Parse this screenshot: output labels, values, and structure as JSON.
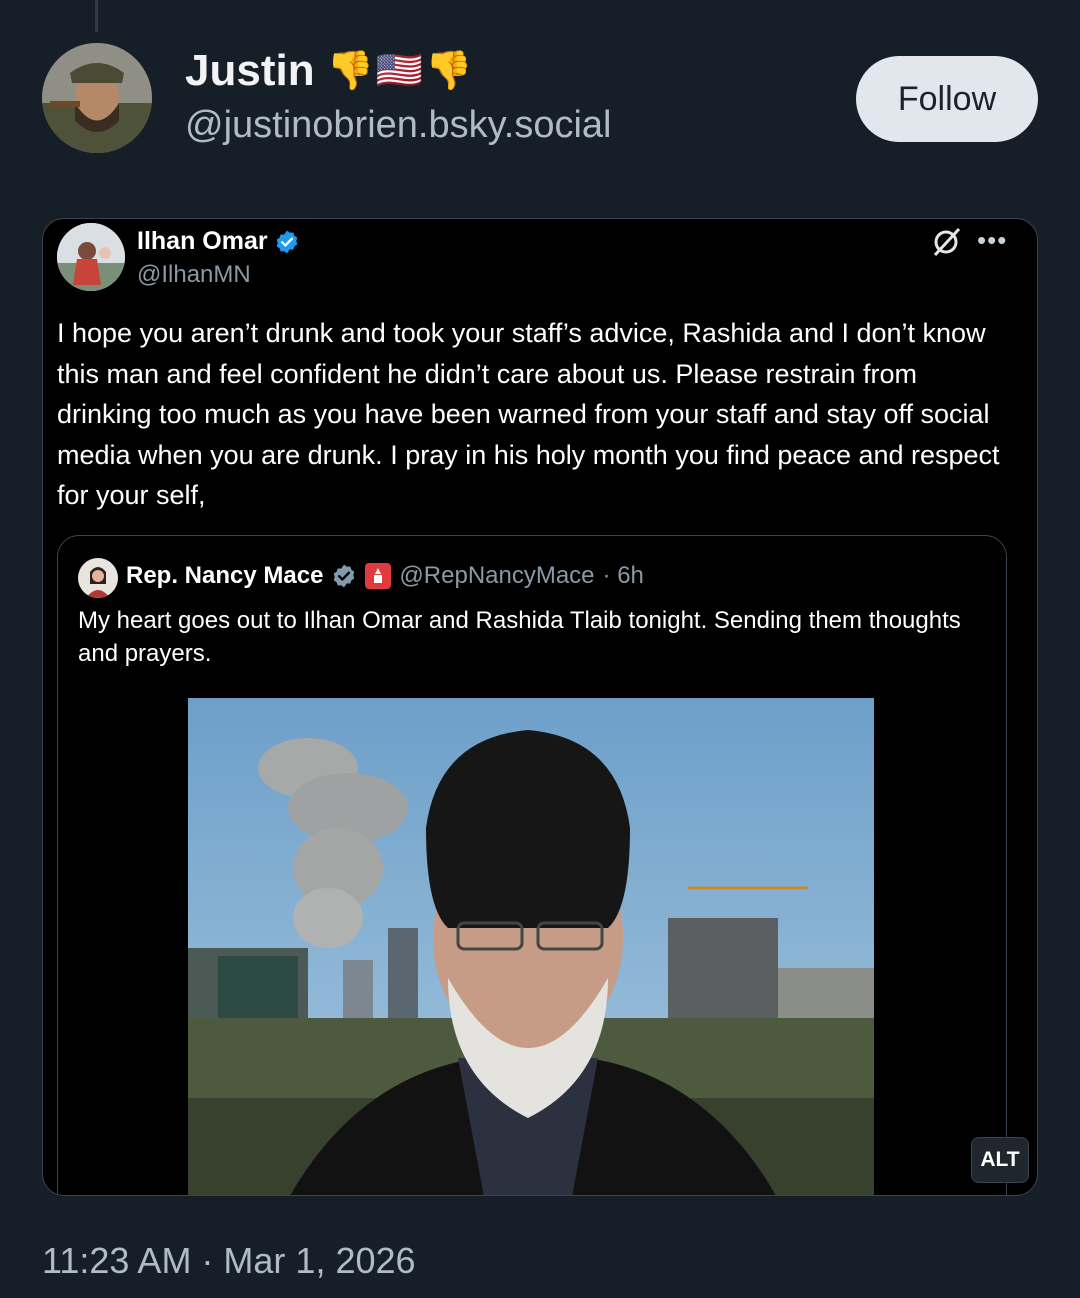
{
  "post": {
    "author": {
      "display_name": "Justin",
      "emojis": [
        "👎",
        "🇺🇸",
        "👎"
      ],
      "handle": "@justinobrien.bsky.social"
    },
    "follow_label": "Follow",
    "timestamp": "11:23 AM · Mar 1, 2026"
  },
  "embedded_tweet": {
    "author": {
      "display_name": "Ilhan Omar",
      "handle": "@IlhanMN",
      "verified": true
    },
    "body": "I hope you aren’t drunk and took your staff’s advice, Rashida and I don’t know this man and feel confident he didn’t care about us. Please restrain from drinking too much as you have been warned from your staff and stay off social media when you are drunk. I pray in his holy month you find peace and respect for your self,",
    "quoted": {
      "display_name": "Rep. Nancy Mace",
      "handle": "@RepNancyMace",
      "age": "· 6h",
      "body": "My heart goes out to Ilhan Omar and Rashida Tlaib tonight. Sending them thoughts and prayers."
    },
    "alt_badge": "ALT"
  },
  "colors": {
    "background": "#161e27",
    "embed_background": "#000000",
    "verified_blue": "#1d9bf0",
    "muted_text": "#aebbc9"
  },
  "icons": [
    "thumbs-down-icon",
    "us-flag-icon",
    "verified-icon",
    "grok-icon",
    "more-icon",
    "congress-badge-icon"
  ]
}
